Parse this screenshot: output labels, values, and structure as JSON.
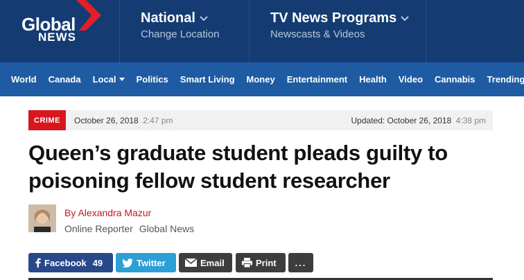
{
  "header": {
    "logo_line1": "Global",
    "logo_line2": "NEWS",
    "national": {
      "title": "National",
      "subtitle": "Change Location"
    },
    "tv": {
      "title": "TV News Programs",
      "subtitle": "Newscasts & Videos"
    }
  },
  "section_nav": {
    "items": [
      "World",
      "Canada",
      "Local",
      "Politics",
      "Smart Living",
      "Money",
      "Entertainment",
      "Health",
      "Video",
      "Cannabis",
      "Trending"
    ]
  },
  "article": {
    "category": "CRIME",
    "published_date": "October 26, 2018",
    "published_time": "2:47 pm",
    "updated_label": "Updated: October 26, 2018",
    "updated_time": "4:38 pm",
    "headline": "Queen’s graduate student pleads guilty to poisoning fellow student researcher",
    "author": {
      "by": "By",
      "name": "Alexandra Mazur",
      "role": "Online Reporter",
      "org": "Global News"
    }
  },
  "share": {
    "facebook_label": "Facebook",
    "facebook_count": "49",
    "twitter_label": "Twitter",
    "email_label": "Email",
    "print_label": "Print",
    "more_label": "..."
  },
  "colors": {
    "header_bg": "#143c73",
    "nav_bg": "#1f5ba3",
    "accent_red": "#d7161e",
    "facebook": "#27498a",
    "twitter": "#2c9fd6"
  },
  "icons": [
    "chevron-down-icon",
    "caret-down-icon",
    "facebook-icon",
    "twitter-icon",
    "email-icon",
    "print-icon"
  ]
}
